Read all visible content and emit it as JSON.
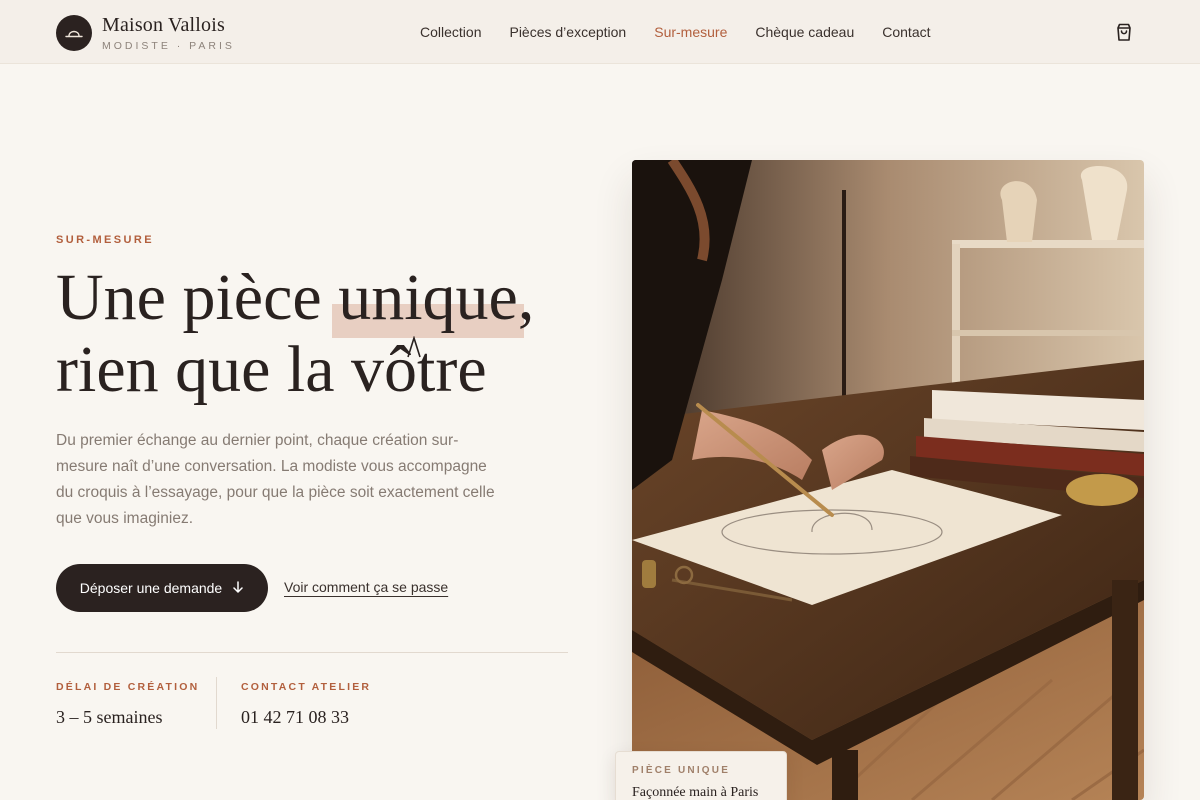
{
  "brand": {
    "name": "Maison Vallois",
    "subtitle": "MODISTE · PARIS"
  },
  "nav": {
    "items": [
      {
        "label": "Collection",
        "active": false
      },
      {
        "label": "Pièces d’exception",
        "active": false
      },
      {
        "label": "Sur-mesure",
        "active": true
      },
      {
        "label": "Chèque cadeau",
        "active": false
      },
      {
        "label": "Contact",
        "active": false
      }
    ],
    "cart_icon": "shopping-bag-icon"
  },
  "hero": {
    "eyebrow": "SUR-MESURE",
    "headline_part1": "Une pièce ",
    "headline_highlight": "unique",
    "headline_part2": ",",
    "headline_line2": "rien que la vôtre",
    "intro": "Du premier échange au dernier point, chaque création sur-mesure naît d’une conversation. La modiste vous accompagne du croquis à l’essayage, pour que la pièce soit exactement celle que vous imaginiez.",
    "primary_cta": "Déposer une demande",
    "secondary_cta": "Voir comment ça se passe"
  },
  "stats": [
    {
      "label": "DÉLAI DE CRÉATION",
      "value": "3 – 5 semaines"
    },
    {
      "label": "CONTACT ATELIER",
      "value": "01 42 71 08 33"
    }
  ],
  "photo_badge": {
    "label": "PIÈCE UNIQUE",
    "text": "Façonnée main à Paris"
  },
  "colors": {
    "accent": "#b25f3d",
    "dark": "#2b2220",
    "background": "#f9f6f1",
    "highlight": "#e8cfc2"
  }
}
